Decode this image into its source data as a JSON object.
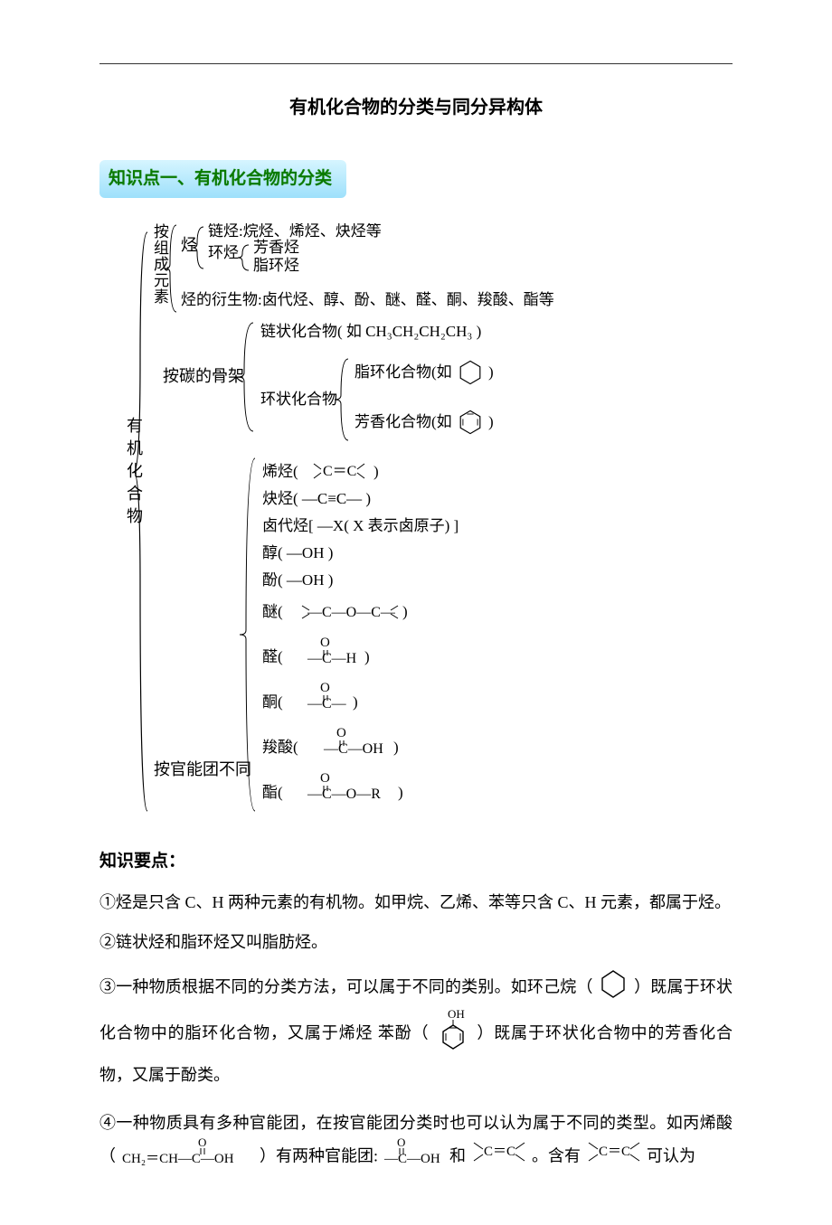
{
  "title": "有机化合物的分类与同分异构体",
  "section1_banner": "知识点一、有机化合物的分类",
  "diagram": {
    "root": "有机化合物",
    "branches": {
      "byElement": {
        "label": "按组成元素",
        "items": {
          "ting": "烃",
          "lianTing": "链烃:烷烃、烯烃、炔烃等",
          "huanTing": "环烃",
          "fangxiangTing": "芳香烃",
          "zhihuanTing": "脂环烃",
          "deriv": "烃的衍生物:卤代烃、醇、酚、醚、醛、酮、羧酸、酯等"
        }
      },
      "bySkeleton": {
        "label": "按碳的骨架",
        "items": {
          "chain": "链状化合物( 如 CH₃CH₂CH₂CH₃ )",
          "ring": "环状化合物",
          "aliRing": "脂环化合物(如",
          "aliRingEnd": ")",
          "aroRing": "芳香化合物(如",
          "aroRingEnd": ")"
        }
      },
      "byGroup": {
        "label": "按官能团不同",
        "items": [
          "烯烃(",
          "炔烃(  —C≡C—  )",
          "卤代烃[ —X( X 表示卤原子) ]",
          "醇( —OH )",
          "酚( —OH )",
          "醚(",
          "醛(",
          "酮(",
          "羧酸(",
          "酯("
        ],
        "closeParen": ")"
      }
    }
  },
  "kp_head": "知识要点：",
  "kp1": "①烃是只含 C、H 两种元素的有机物。如甲烷、乙烯、苯等只含 C、H 元素，都属于烃。",
  "kp2": "②链状烃和脂环烃又叫脂肪烃。",
  "kp3a": "③一种物质根据不同的分类方法，可以属于不同的类别。如环己烷（",
  "kp3b": "）既属于环状化合物中的脂环化合物，又属于烯烃  苯酚（",
  "kp3c": "）既属于环状化合物中的芳香化合物，又属于酚类。",
  "kp4a": "④一种物质具有多种官能团，在按官能团分类时也可以认为属于不同的类型。如丙烯酸（",
  "kp4b": "）有两种官能团: ",
  "kp4c": "  和  ",
  "kp4d": "。含有",
  "kp4e": "可认为",
  "chem": {
    "acrylic": "CH₂＝CH—C—OH",
    "cooh": "—C—OH",
    "cc1": "C＝C",
    "cc2": "C＝C",
    "dblO": "O",
    "phenolOH": "OH"
  }
}
